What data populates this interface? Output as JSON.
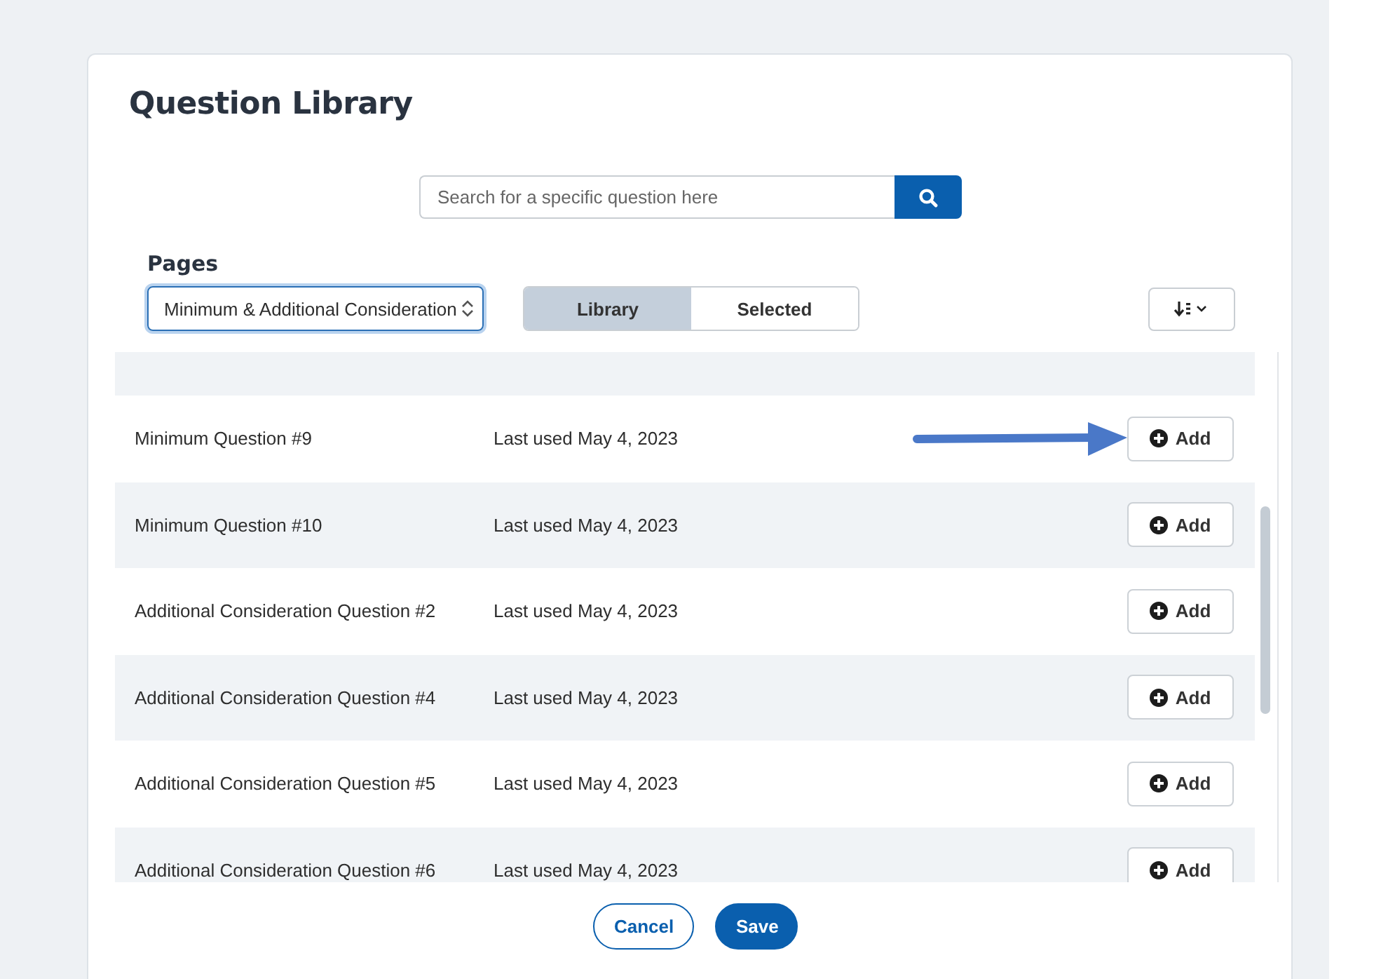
{
  "dialog": {
    "title": "Question Library"
  },
  "search": {
    "placeholder": "Search for a specific question here"
  },
  "pages": {
    "label": "Pages",
    "value": "Minimum & Additional Consideration"
  },
  "tabs": [
    {
      "label": "Library",
      "selected": true
    },
    {
      "label": "Selected",
      "selected": false
    }
  ],
  "questions": [
    {
      "name": "Minimum Question #9",
      "last_used": "Last used May 4, 2023",
      "action": "Add",
      "pointed": true
    },
    {
      "name": "Minimum Question #10",
      "last_used": "Last used May 4, 2023",
      "action": "Add",
      "pointed": false
    },
    {
      "name": "Additional Consideration Question #2",
      "last_used": "Last used May 4, 2023",
      "action": "Add",
      "pointed": false
    },
    {
      "name": "Additional Consideration Question #4",
      "last_used": "Last used May 4, 2023",
      "action": "Add",
      "pointed": false
    },
    {
      "name": "Additional Consideration Question #5",
      "last_used": "Last used May 4, 2023",
      "action": "Add",
      "pointed": false
    },
    {
      "name": "Additional Consideration Question #6",
      "last_used": "Last used May 4, 2023",
      "action": "Add",
      "pointed": false
    }
  ],
  "buttons": [
    {
      "label": "Cancel",
      "kind": "secondary"
    },
    {
      "label": "Save",
      "kind": "primary"
    }
  ]
}
